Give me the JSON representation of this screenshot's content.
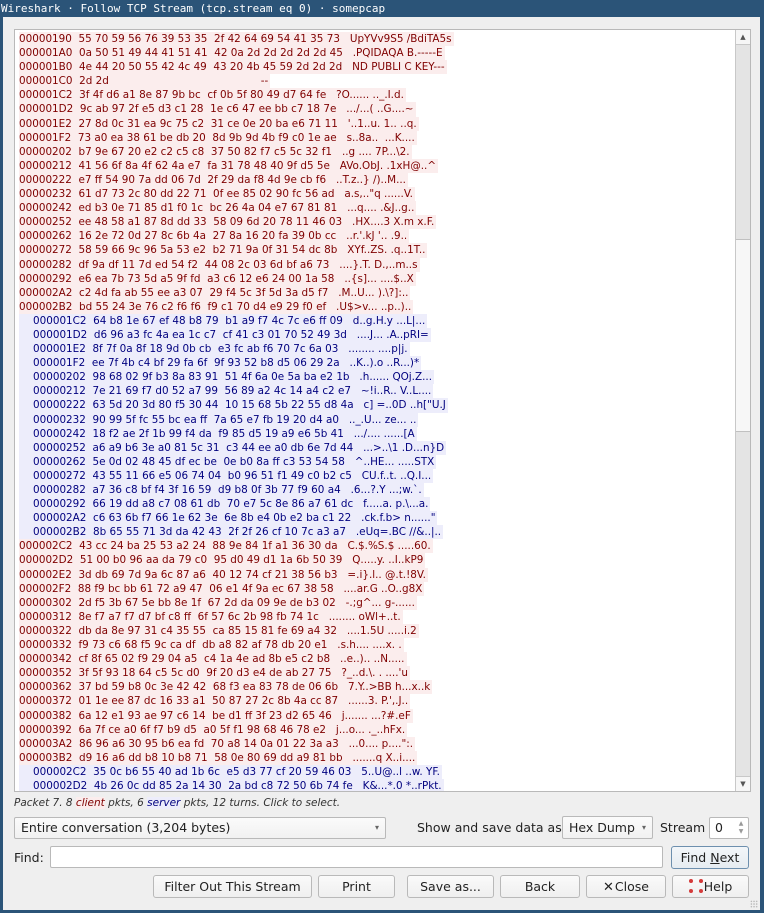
{
  "window": {
    "title": "Wireshark · Follow TCP Stream (tcp.stream eq 0) · somepcap"
  },
  "colors": {
    "client_fg": "#7f0000",
    "client_bg": "#fbeded",
    "server_fg": "#00007f",
    "server_bg": "#ededfb",
    "titlebar": "#2b5478"
  },
  "stream": {
    "lines": [
      {
        "dir": "client",
        "text": "00000190  55 70 59 56 76 39 53 35  2f 42 64 69 54 41 35 73   UpYVv9S5 /BdiTA5s"
      },
      {
        "dir": "client",
        "text": "000001A0  0a 50 51 49 44 41 51 41  42 0a 2d 2d 2d 2d 2d 45   .PQIDAQA B.-----E"
      },
      {
        "dir": "client",
        "text": "000001B0  4e 44 20 50 55 42 4c 49  43 20 4b 45 59 2d 2d 2d   ND PUBLI C KEY---"
      },
      {
        "dir": "client",
        "text": "000001C0  2d 2d                                              --"
      },
      {
        "dir": "client",
        "text": "000001C2  3f 4f d6 a1 8e 87 9b bc  cf 0b 5f 80 49 d7 64 fe   ?O...... .._.I.d."
      },
      {
        "dir": "client",
        "text": "000001D2  9c ab 97 2f e5 d3 c1 28  1e c6 47 ee bb c7 18 7e   .../...( ..G....~"
      },
      {
        "dir": "client",
        "text": "000001E2  27 8d 0c 31 ea 9c 75 c2  31 ce 0e 20 ba e6 71 11   '..1..u. 1.. ..q."
      },
      {
        "dir": "client",
        "text": "000001F2  73 a0 ea 38 61 be db 20  8d 9b 9d 4b f9 c0 1e ae   s..8a..  ...K...."
      },
      {
        "dir": "client",
        "text": "00000202  b7 9e 67 20 e2 c2 c5 c8  37 50 82 f7 c5 5c 32 f1   ..g .... 7P...\\2."
      },
      {
        "dir": "client",
        "text": "00000212  41 56 6f 8a 4f 62 4a e7  fa 31 78 48 40 9f d5 5e   AVo.ObJ. .1xH@..^"
      },
      {
        "dir": "client",
        "text": "00000222  e7 ff 54 90 7a dd 06 7d  2f 29 da f8 4d 9e cb f6   ..T.z..} /)..M..."
      },
      {
        "dir": "client",
        "text": "00000232  61 d7 73 2c 80 dd 22 71  0f ee 85 02 90 fc 56 ad   a.s,..\"q ......V."
      },
      {
        "dir": "client",
        "text": "00000242  ed b3 0e 71 85 d1 f0 1c  bc 26 4a 04 e7 67 81 81   ...q.... .&J..g.."
      },
      {
        "dir": "client",
        "text": "00000252  ee 48 58 a1 87 8d dd 33  58 09 6d 20 78 11 46 03   .HX....3 X.m x.F."
      },
      {
        "dir": "client",
        "text": "00000262  16 2e 72 0d 27 8c 6b 4a  27 8a 16 20 fa 39 0b cc   ..r.'.kJ '.. .9.."
      },
      {
        "dir": "client",
        "text": "00000272  58 59 66 9c 96 5a 53 e2  b2 71 9a 0f 31 54 dc 8b   XYf..ZS. .q..1T.."
      },
      {
        "dir": "client",
        "text": "00000282  df 9a df 11 7d ed 54 f2  44 08 2c 03 6d bf a6 73   ....}.T. D.,..m..s"
      },
      {
        "dir": "client",
        "text": "00000292  e6 ea 7b 73 5d a5 9f fd  a3 c6 12 e6 24 00 1a 58   ..{s]... ....$..X"
      },
      {
        "dir": "client",
        "text": "000002A2  c2 4d fa ab 55 ee a3 07  29 f4 5c 3f 5d 3a d5 f7   .M..U... ).\\?]:.."
      },
      {
        "dir": "client",
        "text": "000002B2  bd 55 24 3e 76 c2 f6 f6  f9 c1 70 d4 e9 29 f0 ef   .U$>v... ..p..).."
      },
      {
        "dir": "server",
        "text": "000001C2  64 b8 1e 67 ef 48 b8 79  b1 a9 f7 4c 7c e6 ff 09   d..g.H.y ...L|..."
      },
      {
        "dir": "server",
        "text": "000001D2  d6 96 a3 fc 4a ea 1c c7  cf 41 c3 01 70 52 49 3d   ....J... .A..pRI="
      },
      {
        "dir": "server",
        "text": "000001E2  8f 7f 0a 8f 18 9d 0b cb  e3 fc ab f6 70 7c 6a 03   ........ ....p|j."
      },
      {
        "dir": "server",
        "text": "000001F2  ee 7f 4b c4 bf 29 fa 6f  9f 93 52 b8 d5 06 29 2a   ..K..).o ..R...)*"
      },
      {
        "dir": "server",
        "text": "00000202  98 68 02 9f b3 8a 83 91  51 4f 6a 0e 5a ba e2 1b   .h...... QOj.Z..."
      },
      {
        "dir": "server",
        "text": "00000212  7e 21 69 f7 d0 52 a7 99  56 89 a2 4c 14 a4 c2 e7   ~!i..R.. V..L...."
      },
      {
        "dir": "server",
        "text": "00000222  63 5d 20 3d 80 f5 30 44  10 15 68 5b 22 55 d8 4a   c] =..0D ..h[\"U.J"
      },
      {
        "dir": "server",
        "text": "00000232  90 99 5f fc 55 bc ea ff  7a 65 e7 fb 19 20 d4 a0   .._.U... ze... .."
      },
      {
        "dir": "server",
        "text": "00000242  18 f2 ae 2f 1b 99 f4 da  f9 85 d5 19 a9 e6 5b 41   .../.... ......[A"
      },
      {
        "dir": "server",
        "text": "00000252  a6 a9 b6 3e a0 81 5c 31  c3 44 ee a0 db 6e 7d 44   ...>..\\1 .D...n}D"
      },
      {
        "dir": "server",
        "text": "00000262  5e 0d 02 48 45 df ec be  0e b0 8a ff c3 53 54 58   ^..HE... .....STX"
      },
      {
        "dir": "server",
        "text": "00000272  43 55 11 66 e5 06 74 04  b0 96 51 f1 49 c0 b2 c5   CU.f..t. ..Q.I..."
      },
      {
        "dir": "server",
        "text": "00000282  a7 36 c8 bf f4 3f 16 59  d9 b8 0f 3b 77 f9 60 a4   .6...?.Y ...;w.`."
      },
      {
        "dir": "server",
        "text": "00000292  66 19 dd a8 c7 08 61 db  70 e7 5c 8e 86 a7 61 dc   f.....a. p.\\...a."
      },
      {
        "dir": "server",
        "text": "000002A2  c6 63 6b f7 66 1e 62 3e  6e 8b e4 0b e2 ba c1 22   .ck.f.b> n......\""
      },
      {
        "dir": "server",
        "text": "000002B2  8b 65 55 71 3d da 42 43  2f 2f 26 cf 10 7c a3 a7   .eUq=.BC //&..|.."
      },
      {
        "dir": "client",
        "text": "000002C2  43 cc 24 ba 25 53 a2 24  88 9e 84 1f a1 36 30 da   C.$.%S.$ .....60."
      },
      {
        "dir": "client",
        "text": "000002D2  51 00 b0 96 aa da 79 c0  95 d0 49 d1 1a 6b 50 39   Q.....y. ..I..kP9"
      },
      {
        "dir": "client",
        "text": "000002E2  3d db 69 7d 9a 6c 87 a6  40 12 74 cf 21 38 56 b3   =.i}.l.. @.t.!8V."
      },
      {
        "dir": "client",
        "text": "000002F2  88 f9 bc bb 61 72 a9 47  06 e1 4f 9a ec 67 38 58   ....ar.G ..O..g8X"
      },
      {
        "dir": "client",
        "text": "00000302  2d f5 3b 67 5e bb 8e 1f  67 2d da 09 9e de b3 02   -.;g^... g-......"
      },
      {
        "dir": "client",
        "text": "00000312  8e f7 a7 f7 d7 bf c8 ff  6f 57 6c 2b 98 fb 74 1c   ........ oWl+..t."
      },
      {
        "dir": "client",
        "text": "00000322  db da 8e 97 31 c4 35 55  ca 85 15 81 fe 69 a4 32   ....1.5U .....i.2"
      },
      {
        "dir": "client",
        "text": "00000332  f9 73 c6 68 f5 9c ca df  db a8 82 af 78 db 20 e1   .s.h.... ....x. ."
      },
      {
        "dir": "client",
        "text": "00000342  cf 8f 65 02 f9 29 04 a5  c4 1a 4e ad 8b e5 c2 b8   ..e..).. ..N....."
      },
      {
        "dir": "client",
        "text": "00000352  3f 5f 93 18 64 c5 5c d0  9f 20 d3 e4 de ab 27 75   ?_..d.\\. . ....'u"
      },
      {
        "dir": "client",
        "text": "00000362  37 bd 59 b8 0c 3e 42 42  68 f3 ea 83 78 de 06 6b   7.Y..>BB h...x..k"
      },
      {
        "dir": "client",
        "text": "00000372  01 1e ee 87 dc 16 33 a1  50 87 27 2c 8b 4a cc 87   ......3. P.',.J.."
      },
      {
        "dir": "client",
        "text": "00000382  6a 12 e1 93 ae 97 c6 14  be d1 ff 3f 23 d2 65 46   j....... ...?#.eF"
      },
      {
        "dir": "client",
        "text": "00000392  6a 7f ce a0 6f f7 b9 d5  a0 5f f1 98 68 46 78 e2   j...o... ._..hFx."
      },
      {
        "dir": "client",
        "text": "000003A2  86 96 a6 30 95 b6 ea fd  70 a8 14 0a 01 22 3a a3   ...0.... p....\":."
      },
      {
        "dir": "client",
        "text": "000003B2  d9 16 a6 dd b8 10 b8 71  58 0e 80 69 dd a9 81 bb   .......q X..i...."
      },
      {
        "dir": "server",
        "text": "000002C2  35 0c b6 55 40 ad 1b 6c  e5 d3 77 cf 20 59 46 03   5..U@..l ..w. YF."
      },
      {
        "dir": "server",
        "text": "000002D2  4b 26 0c dd 85 2a 14 30  2a bd c8 72 50 6b 74 fe   K&...*.0 *..rPkt."
      }
    ],
    "scroll": {
      "up_icon": "▲",
      "down_icon": "▼",
      "position_fraction": 0.28
    }
  },
  "status": {
    "prefix": "Packet 7. 8 ",
    "client_word": "client",
    "middle": " pkts, 6 ",
    "server_word": "server",
    "suffix": " pkts, 12 turns. Click to select."
  },
  "controls": {
    "conversation_selected": "Entire conversation (3,204 bytes)",
    "show_label": "Show and save data as",
    "format_selected": "Hex Dump",
    "stream_label": "Stream",
    "stream_value": "0",
    "find_label": "Find:",
    "find_value": "",
    "find_next_pre": "Find ",
    "find_next_mnemonic": "N",
    "find_next_post": "ext"
  },
  "buttons": {
    "filter_out": "Filter Out This Stream",
    "print": "Print",
    "save_as": "Save as...",
    "back": "Back",
    "close": "Close",
    "help": "Help"
  },
  "icons": {
    "close": "close-x-icon",
    "help": "help-lifebuoy-icon",
    "dropdown": "▾",
    "spin_up": "▲",
    "spin_down": "▼"
  }
}
